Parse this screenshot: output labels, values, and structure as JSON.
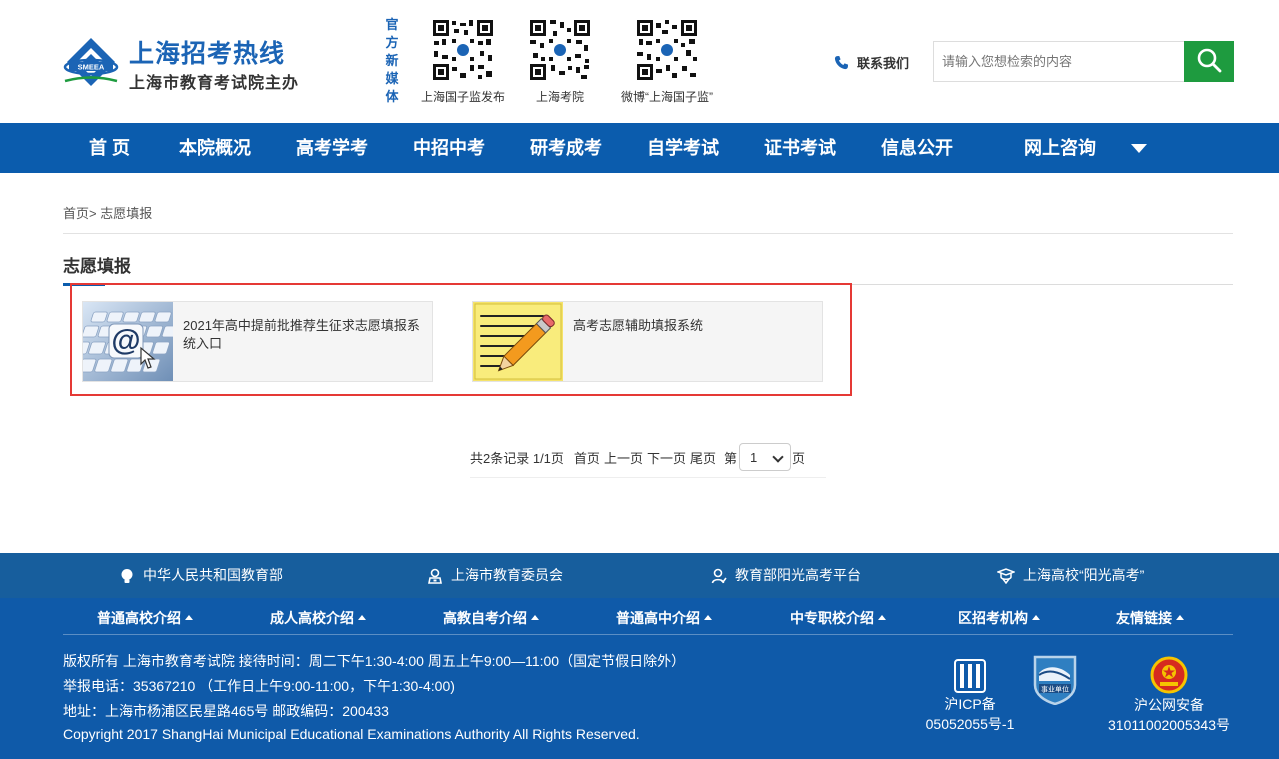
{
  "header": {
    "logo_title": "上海招考热线",
    "logo_sub": "上海市教育考试院主办",
    "logo_emblem_text": "SMEEA",
    "media_label": "官方新媒体",
    "qr_codes": [
      {
        "caption": "上海国子监发布"
      },
      {
        "caption": "上海考院"
      },
      {
        "caption": "微博“上海国子监”"
      }
    ],
    "contact_label": "联系我们",
    "search_placeholder": "请输入您想检索的内容"
  },
  "nav": {
    "items": [
      "首 页",
      "本院概况",
      "高考学考",
      "中招中考",
      "研考成考",
      "自学考试",
      "证书考试",
      "信息公开",
      "网上咨询"
    ]
  },
  "main": {
    "breadcrumb": "首页> 志愿填报",
    "section_title": "志愿填报",
    "cards": [
      {
        "title": "2021年高中提前批推荐生征求志愿填报系统入口",
        "icon": "keyboard-at-icon"
      },
      {
        "title": "高考志愿辅助填报系统",
        "icon": "notepad-pencil-icon"
      }
    ],
    "pager": {
      "summary": "共2条记录 1/1页",
      "first": "首页",
      "prev": "上一页",
      "next": "下一页",
      "last": "尾页",
      "page_prefix": "第",
      "page_value": "1",
      "page_suffix": "页"
    }
  },
  "footer": {
    "top_links": [
      "中华人民共和国教育部",
      "上海市教育委员会",
      "教育部阳光高考平台",
      "上海高校“阳光高考”"
    ],
    "nav": [
      "普通高校介绍",
      "成人高校介绍",
      "高教自考介绍",
      "普通高中介绍",
      "中专职校介绍",
      "区招考机构",
      "友情链接"
    ],
    "info": [
      "版权所有   上海市教育考试院 接待时间：周二下午1:30-4:00 周五上午9:00—11:00（国定节假日除外）",
      "举报电话：35367210 （工作日上午9:00-11:00，下午1:30-4:00)",
      "地址：上海市杨浦区民星路465号 邮政编码：200433",
      "Copyright 2017 ShangHai Municipal Educational Examinations Authority All Rights Reserved."
    ],
    "icp_line1": "沪ICP备",
    "icp_line2": "05052055号-1",
    "org_badge": "事业单位",
    "police_line1": "沪公网安备",
    "police_line2": "31011002005343号"
  },
  "colors": {
    "brand_blue": "#0b5cad",
    "footer_top": "#175e9d",
    "search_green": "#1e9b3f",
    "highlight_red": "#e53935"
  }
}
